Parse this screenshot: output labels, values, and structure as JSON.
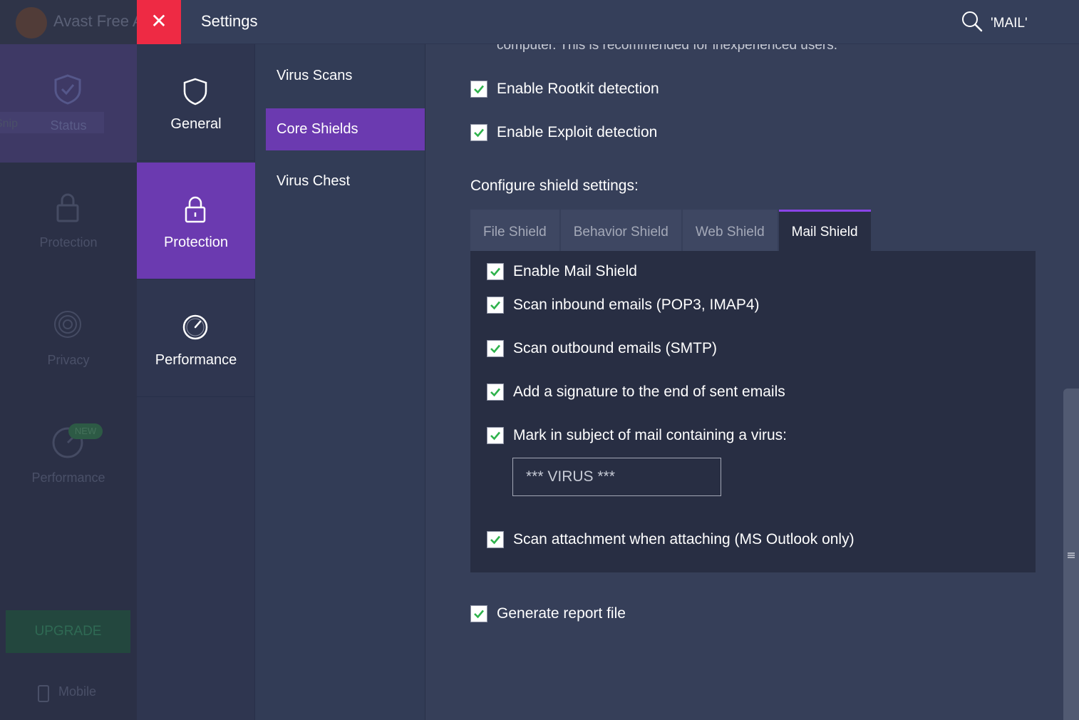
{
  "background_app": {
    "title": "Avast Free A",
    "snip_label": "w Snip",
    "nav": [
      "Status",
      "Protection",
      "Privacy",
      "Performance"
    ],
    "new_badge": "NEW",
    "upgrade_label": "UPGRADE",
    "mobile_label": "Mobile"
  },
  "header": {
    "close_label": "✕",
    "title": "Settings",
    "search_query": "'MAIL'"
  },
  "categories": [
    {
      "label": "General",
      "icon": "shield-icon",
      "active": false
    },
    {
      "label": "Protection",
      "icon": "lock-icon",
      "active": true
    },
    {
      "label": "Performance",
      "icon": "gauge-icon",
      "active": false
    }
  ],
  "subnav": [
    {
      "label": "Virus Scans",
      "active": false
    },
    {
      "label": "Core Shields",
      "active": true
    },
    {
      "label": "Virus Chest",
      "active": false
    }
  ],
  "content": {
    "clipped_text": "computer. This is recommended for inexperienced users.",
    "rootkit": {
      "label": "Enable Rootkit detection",
      "checked": true
    },
    "exploit": {
      "label": "Enable Exploit detection",
      "checked": true
    },
    "section_title": "Configure shield settings:",
    "tabs": [
      {
        "label": "File Shield",
        "active": false
      },
      {
        "label": "Behavior Shield",
        "active": false
      },
      {
        "label": "Web Shield",
        "active": false
      },
      {
        "label": "Mail Shield",
        "active": true
      }
    ],
    "mail_options": [
      {
        "label": "Enable Mail Shield",
        "checked": true
      },
      {
        "label": "Scan inbound emails (POP3, IMAP4)",
        "checked": true
      },
      {
        "label": "Scan outbound emails (SMTP)",
        "checked": true
      },
      {
        "label": "Add a signature to the end of sent emails",
        "checked": true
      },
      {
        "label": "Mark in subject of mail containing a virus:",
        "checked": true
      },
      {
        "label": "Scan attachment when attaching (MS Outlook only)",
        "checked": true
      }
    ],
    "virus_subject_value": "*** VIRUS ***",
    "report_file": {
      "label": "Generate report file",
      "checked": true
    }
  },
  "colors": {
    "accent": "#6b3ab0",
    "close": "#ee2a44",
    "check": "#2fb24c",
    "tab_indicator": "#8a44e8"
  }
}
